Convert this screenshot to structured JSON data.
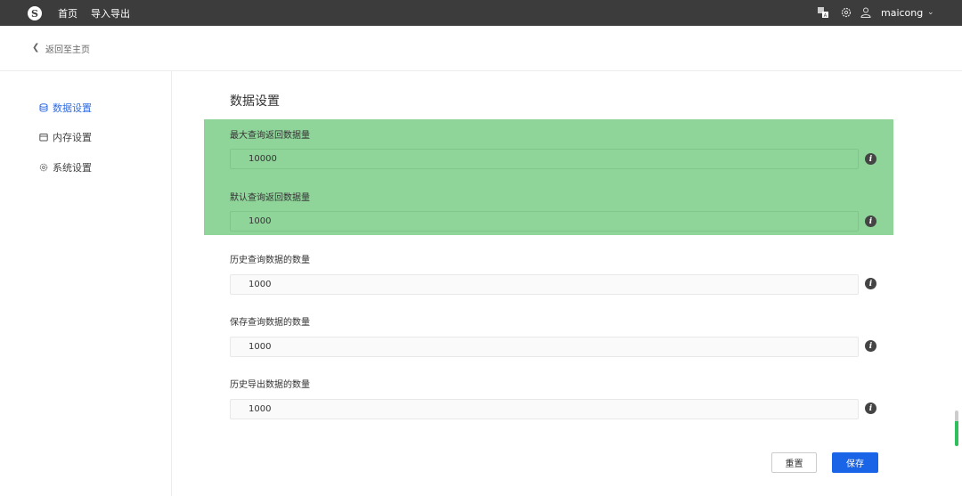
{
  "topbar": {
    "logo_glyph": "S",
    "nav": [
      "首页",
      "导入导出"
    ],
    "username": "maicong",
    "icons": [
      "translate-icon",
      "settings-icon",
      "user-icon",
      "chevron-down-icon"
    ]
  },
  "back": {
    "label": "返回至主页"
  },
  "sidebar": {
    "items": [
      {
        "label": "数据设置",
        "icon": "database-icon",
        "active": true
      },
      {
        "label": "内存设置",
        "icon": "memory-icon",
        "active": false
      },
      {
        "label": "系统设置",
        "icon": "gear-icon",
        "active": false
      }
    ]
  },
  "main": {
    "title": "数据设置",
    "fields": [
      {
        "label": "最大查询返回数据量",
        "value": "10000"
      },
      {
        "label": "默认查询返回数据量",
        "value": "1000"
      },
      {
        "label": "历史查询数据的数量",
        "value": "1000"
      },
      {
        "label": "保存查询数据的数量",
        "value": "1000"
      },
      {
        "label": "历史导出数据的数量",
        "value": "1000"
      }
    ],
    "info_glyph": "i",
    "reset_label": "重置",
    "save_label": "保存"
  },
  "colors": {
    "accent": "#1a64e8",
    "highlight": "#8fd59a",
    "topbar": "#3c3c3c"
  }
}
